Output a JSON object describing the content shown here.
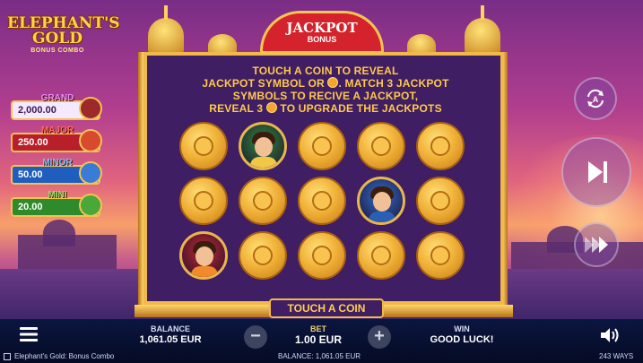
{
  "game": {
    "logo_title_line1": "ELEPHANT'S",
    "logo_title_line2": "GOLD",
    "logo_subtitle": "BONUS COMBO"
  },
  "jackpots": [
    {
      "label": "GRAND",
      "value": "2,000.00",
      "color": "#c9a6f0"
    },
    {
      "label": "MAJOR",
      "value": "250.00",
      "color": "#c0232d"
    },
    {
      "label": "MINOR",
      "value": "50.00",
      "color": "#2a6fd3"
    },
    {
      "label": "MINI",
      "value": "20.00",
      "color": "#2f8a2c"
    }
  ],
  "bonus_panel": {
    "title": "JACKPOT",
    "subtitle": "BONUS",
    "instruction_line1": "TOUCH A COIN TO REVEAL",
    "instruction_line2a": "JACKPOT SYMBOL OR",
    "instruction_line2b": ". MATCH 3 JACKPOT",
    "instruction_line3": "SYMBOLS TO RECIVE A JACKPOT,",
    "instruction_line4a": "REVEAL 3",
    "instruction_line4b": "TO UPGRADE THE JACKPOTS",
    "touch_button": "TOUCH A COIN"
  },
  "grid": {
    "rows": [
      [
        "coin",
        "char-green",
        "coin",
        "coin",
        "coin"
      ],
      [
        "coin",
        "coin",
        "coin",
        "char-blue",
        "coin"
      ],
      [
        "char-red",
        "coin",
        "coin",
        "coin",
        "coin"
      ]
    ]
  },
  "controls": {
    "autoplay_icon": "autoplay-icon",
    "spin_icon": "skip-icon",
    "turbo_icon": "turbo-icon"
  },
  "bottom_bar": {
    "balance_label": "BALANCE",
    "balance_value": "1,061.05 EUR",
    "bet_label": "BET",
    "bet_value": "1.00 EUR",
    "win_label": "WIN",
    "win_value": "GOOD LUCK!",
    "ways": "243 WAYS",
    "footer_game": "Elephant's Gold: Bonus Combo",
    "footer_balance": "BALANCE: 1,061.05 EUR"
  }
}
